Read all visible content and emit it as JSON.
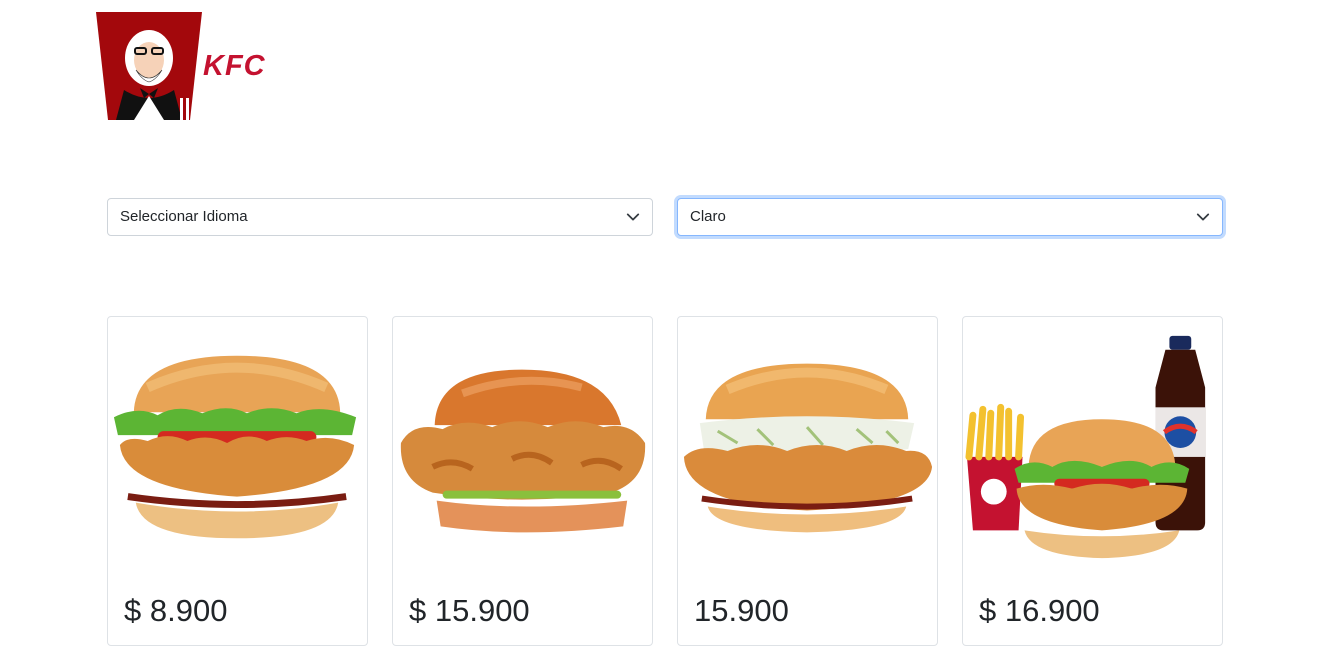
{
  "brand": {
    "name": "KFC",
    "logo_icon": "colonel-logo-icon",
    "color": "#c41230"
  },
  "filters": {
    "language": {
      "selected": "Seleccionar Idioma"
    },
    "theme": {
      "selected": "Claro"
    }
  },
  "products": [
    {
      "image_icon": "chicken-sandwich-lettuce-tomato-icon",
      "price": "$ 8.900"
    },
    {
      "image_icon": "crispy-chicken-sandwich-pickles-icon",
      "price": "$ 15.900"
    },
    {
      "image_icon": "chicken-sandwich-coleslaw-icon",
      "price": "15.900"
    },
    {
      "image_icon": "combo-sandwich-fries-soda-icon",
      "price": "$ 16.900"
    }
  ],
  "colors": {
    "focus_ring": "#86b7fe",
    "border": "#ced4da"
  }
}
